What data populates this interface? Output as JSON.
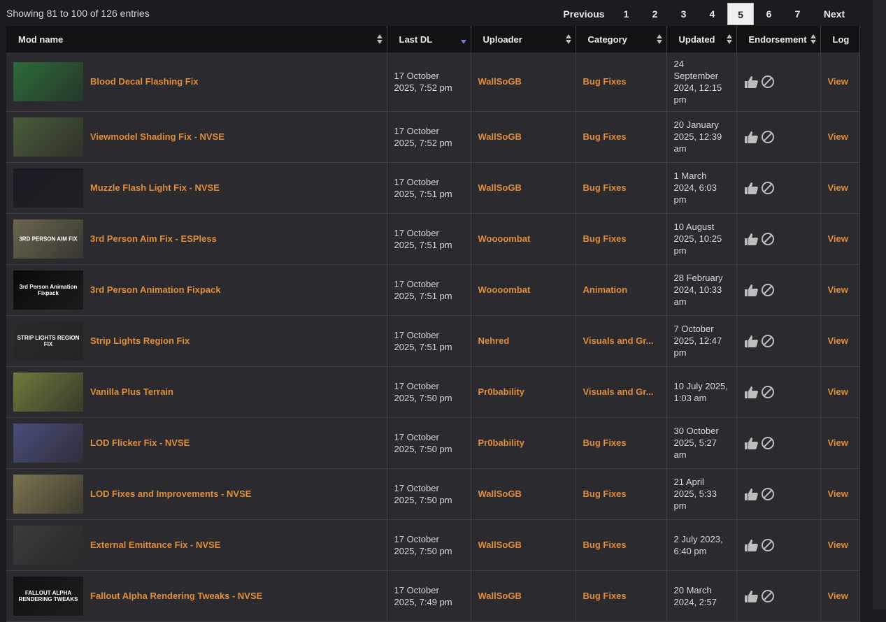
{
  "info_text": "Showing 81 to 100 of 126 entries",
  "pagination": {
    "previous": "Previous",
    "next": "Next",
    "pages": [
      "1",
      "2",
      "3",
      "4",
      "5",
      "6",
      "7"
    ],
    "active": "5"
  },
  "columns": {
    "mod_name": "Mod name",
    "last_dl": "Last DL",
    "uploader": "Uploader",
    "category": "Category",
    "updated": "Updated",
    "endorsement": "Endorsement",
    "log": "Log"
  },
  "rows": [
    {
      "name": "Blood Decal Flashing Fix",
      "last_dl": "17 October 2025, 7:52 pm",
      "uploader": "WallSoGB",
      "category": "Bug Fixes",
      "updated": "24 September 2024, 12:15 pm",
      "log": "View",
      "thumb_color": "#2d6b3a"
    },
    {
      "name": "Viewmodel Shading Fix - NVSE",
      "last_dl": "17 October 2025, 7:52 pm",
      "uploader": "WallSoGB",
      "category": "Bug Fixes",
      "updated": "20 January 2025, 12:39 am",
      "log": "View",
      "thumb_color": "#4a5b3a"
    },
    {
      "name": "Muzzle Flash Light Fix - NVSE",
      "last_dl": "17 October 2025, 7:51 pm",
      "uploader": "WallSoGB",
      "category": "Bug Fixes",
      "updated": "1 March 2024, 6:03 pm",
      "log": "View",
      "thumb_color": "#1b1b24"
    },
    {
      "name": "3rd Person Aim Fix - ESPless",
      "last_dl": "17 October 2025, 7:51 pm",
      "uploader": "Woooombat",
      "category": "Bug Fixes",
      "updated": "10 August 2025, 10:25 pm",
      "log": "View",
      "thumb_color": "#6b6650",
      "thumb_text": "3RD PERSON AIM FIX"
    },
    {
      "name": "3rd Person Animation Fixpack",
      "last_dl": "17 October 2025, 7:51 pm",
      "uploader": "Woooombat",
      "category": "Animation",
      "updated": "28 February 2024, 10:33 am",
      "log": "View",
      "thumb_color": "#0a0a0a",
      "thumb_text": "3rd Person Animation Fixpack"
    },
    {
      "name": "Strip Lights Region Fix",
      "last_dl": "17 October 2025, 7:51 pm",
      "uploader": "Nehred",
      "category": "Visuals and Gr...",
      "updated": "7 October 2025, 12:47 pm",
      "log": "View",
      "thumb_color": "#2a2a2a",
      "thumb_text": "STRIP LIGHTS REGION FIX"
    },
    {
      "name": "Vanilla Plus Terrain",
      "last_dl": "17 October 2025, 7:50 pm",
      "uploader": "Pr0bability",
      "category": "Visuals and Gr...",
      "updated": "10 July 2025, 1:03 am",
      "log": "View",
      "thumb_color": "#6e7a3c"
    },
    {
      "name": "LOD Flicker Fix - NVSE",
      "last_dl": "17 October 2025, 7:50 pm",
      "uploader": "Pr0bability",
      "category": "Bug Fixes",
      "updated": "30 October 2025, 5:27 am",
      "log": "View",
      "thumb_color": "#4a4d7a"
    },
    {
      "name": "LOD Fixes and Improvements - NVSE",
      "last_dl": "17 October 2025, 7:50 pm",
      "uploader": "WallSoGB",
      "category": "Bug Fixes",
      "updated": "21 April 2025, 5:33 pm",
      "log": "View",
      "thumb_color": "#7d7550"
    },
    {
      "name": "External Emittance Fix - NVSE",
      "last_dl": "17 October 2025, 7:50 pm",
      "uploader": "WallSoGB",
      "category": "Bug Fixes",
      "updated": "2 July 2023, 6:40 pm",
      "log": "View",
      "thumb_color": "#3b3b3b"
    },
    {
      "name": "Fallout Alpha Rendering Tweaks - NVSE",
      "last_dl": "17 October 2025, 7:49 pm",
      "uploader": "WallSoGB",
      "category": "Bug Fixes",
      "updated": "20 March 2024, 2:57",
      "log": "View",
      "thumb_color": "#111111",
      "thumb_text": "FALLOUT ALPHA RENDERING TWEAKS"
    }
  ]
}
